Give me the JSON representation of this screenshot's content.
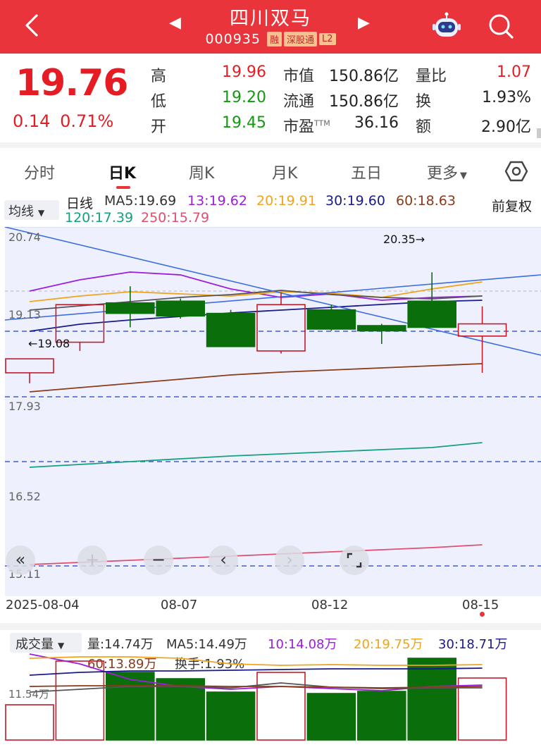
{
  "header": {
    "stock_name": "四川双马",
    "stock_code": "000935",
    "tags": [
      "融",
      "深股通",
      "L2"
    ],
    "bg_color": "#e8343a"
  },
  "quote": {
    "price": "19.76",
    "change": "0.14",
    "change_pct": "0.71%",
    "labels": {
      "high": "高",
      "low": "低",
      "open": "开",
      "mcap": "市值",
      "float": "流通",
      "pe": "市盈",
      "pe_sup": "TTM",
      "vol_ratio": "量比",
      "turnover": "换",
      "amount": "额"
    },
    "high": "19.96",
    "low": "19.20",
    "open": "19.45",
    "mcap": "150.86亿",
    "float": "150.86亿",
    "pe": "36.16",
    "vol_ratio": "1.07",
    "turnover": "1.93%",
    "amount": "2.90亿"
  },
  "tabs": [
    "分时",
    "日K",
    "周K",
    "月K",
    "五日",
    "更多"
  ],
  "active_tab": "日K",
  "ma_legend": {
    "dropdown": "均线",
    "period": "日线",
    "adjust": "前复权",
    "items": [
      {
        "text": "MA5:19.69",
        "color": "#333333"
      },
      {
        "text": "13:19.62",
        "color": "#9b1fd9"
      },
      {
        "text": "20:19.91",
        "color": "#f0a41c"
      },
      {
        "text": "30:19.60",
        "color": "#1a1a8a"
      },
      {
        "text": "60:18.63",
        "color": "#8a3b1a"
      },
      {
        "text": "120:17.39",
        "color": "#15a07f"
      },
      {
        "text": "250:15.79",
        "color": "#e04f6e"
      }
    ]
  },
  "chart_data": {
    "type": "candlestick",
    "price_axis_labels": [
      "20.74",
      "19.13",
      "17.93",
      "16.52",
      "15.11"
    ],
    "dates": [
      "2025-08-04",
      "08-07",
      "08-12",
      "08-15"
    ],
    "annotations": [
      "20.35→",
      "←19.08"
    ],
    "candles": [
      {
        "open": 19.2,
        "close": 19.36,
        "high": 19.36,
        "low": 19.08,
        "dir": "up"
      },
      {
        "open": 19.55,
        "close": 19.98,
        "high": 19.98,
        "low": 19.45,
        "dir": "up"
      },
      {
        "open": 20.0,
        "close": 19.88,
        "high": 20.19,
        "low": 19.72,
        "dir": "down"
      },
      {
        "open": 20.02,
        "close": 19.85,
        "high": 20.05,
        "low": 19.82,
        "dir": "down"
      },
      {
        "open": 19.88,
        "close": 19.5,
        "high": 19.92,
        "low": 19.5,
        "dir": "down"
      },
      {
        "open": 19.45,
        "close": 19.98,
        "high": 20.12,
        "low": 19.42,
        "dir": "up"
      },
      {
        "open": 19.92,
        "close": 19.7,
        "high": 19.98,
        "low": 19.68,
        "dir": "down"
      },
      {
        "open": 19.74,
        "close": 19.68,
        "high": 19.76,
        "low": 19.53,
        "dir": "down"
      },
      {
        "open": 20.02,
        "close": 19.72,
        "high": 20.35,
        "low": 19.72,
        "dir": "down"
      },
      {
        "open": 19.62,
        "close": 19.76,
        "high": 19.96,
        "low": 19.2,
        "dir": "up"
      }
    ]
  },
  "volume": {
    "dropdown": "成交量",
    "items": [
      {
        "text": "量:14.74万",
        "color": "#333333"
      },
      {
        "text": "MA5:14.49万",
        "color": "#333333"
      },
      {
        "text": "10:14.08万",
        "color": "#9b1fd9"
      },
      {
        "text": "20:19.75万",
        "color": "#f0a41c"
      },
      {
        "text": "30:18.71万",
        "color": "#1a1a8a"
      },
      {
        "text": "60:13.89万",
        "color": "#8a3b1a"
      },
      {
        "text": "换手:1.93%",
        "color": "#333333"
      }
    ],
    "axis_label": "11.54万",
    "values": [
      5.0,
      11.2,
      9.6,
      8.7,
      6.8,
      9.6,
      6.6,
      6.9,
      11.6,
      8.8
    ],
    "dirs": [
      "up",
      "up",
      "down",
      "down",
      "down",
      "up",
      "down",
      "down",
      "down",
      "up"
    ]
  }
}
